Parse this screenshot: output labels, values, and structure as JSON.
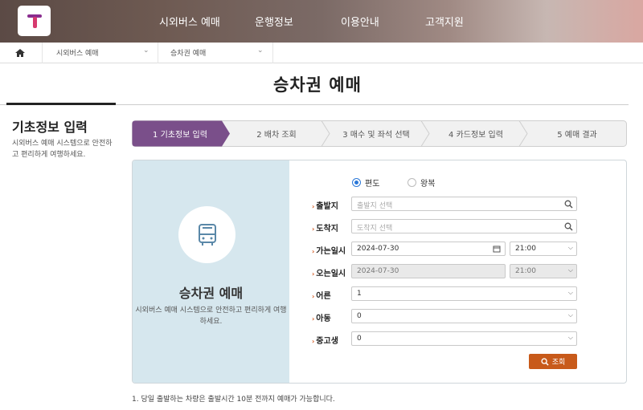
{
  "header": {
    "logo_letter": "T",
    "nav": [
      "시외버스 예매",
      "운행정보",
      "이용안내",
      "고객지원"
    ]
  },
  "breadcrumb": {
    "home_icon": "home-icon",
    "items": [
      "시외버스 예매",
      "승차권 예매"
    ]
  },
  "page_title": "승차권 예매",
  "aside": {
    "title": "기초정보 입력",
    "desc": "시외버스 예매 시스템으로 안전하고 편리하게 여행하세요."
  },
  "steps": [
    "1 기초정보 입력",
    "2 배차 조회",
    "3 매수 및 좌석 선택",
    "4 카드정보 입력",
    "5 예매 결과"
  ],
  "card_left": {
    "icon": "bus-icon",
    "title": "승차권 예매",
    "desc": "시외버스 예매 시스템으로 안전하고 편리하게 여행하세요."
  },
  "form": {
    "trip_type": {
      "one_way": "편도",
      "round_trip": "왕복",
      "selected": "편도"
    },
    "departure": {
      "label": "출발지",
      "placeholder": "출발지 선택"
    },
    "arrival": {
      "label": "도착지",
      "placeholder": "도착지 선택"
    },
    "depart_datetime": {
      "label": "가는일시",
      "date": "2024-07-30",
      "time": "21:00"
    },
    "return_datetime": {
      "label": "오는일시",
      "date": "2024-07-30",
      "time": "21:00"
    },
    "adult": {
      "label": "어른",
      "value": "1"
    },
    "child": {
      "label": "아동",
      "value": "0"
    },
    "teen": {
      "label": "중고생",
      "value": "0"
    },
    "search_button": "조회"
  },
  "footnote": "1.  당일 출발하는 차량은 출발시간 10분 전까지 예매가 가능합니다.",
  "colors": {
    "accent": "#c85a1a",
    "step_active": "#7a4f8a",
    "card_left_bg": "#d6e7ee"
  }
}
